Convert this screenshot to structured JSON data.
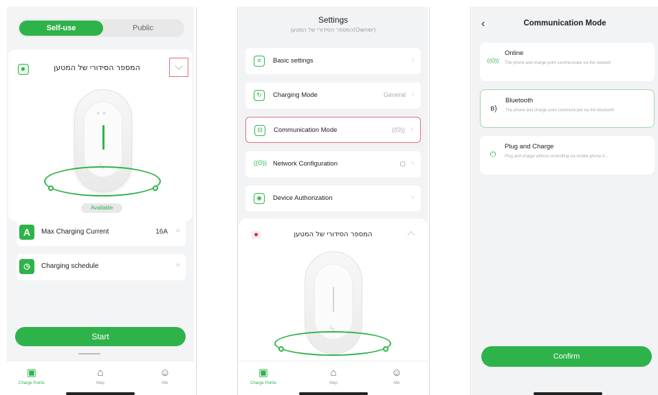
{
  "screen1": {
    "segment": {
      "active": "Self-use",
      "inactive": "Public"
    },
    "device_name": "המספר הסידורי של המטען",
    "status": "Available",
    "max_current": {
      "label": "Max Charging Current",
      "value": "16A"
    },
    "schedule": {
      "label": "Charging schedule"
    },
    "start_label": "Start",
    "tabs": [
      {
        "label": "Charge Points",
        "icon": "charger-icon"
      },
      {
        "label": "Map",
        "icon": "map-icon"
      },
      {
        "label": "Me",
        "icon": "user-icon"
      }
    ]
  },
  "screen2": {
    "title": "Settings",
    "subtitle": "המספר הסידורי של המטען(Owner)",
    "rows": [
      {
        "label": "Basic settings",
        "value": ""
      },
      {
        "label": "Charging Mode",
        "value": "General"
      },
      {
        "label": "Communication Mode",
        "value": "((ʘ))"
      },
      {
        "label": "Network Configuration",
        "value": ""
      },
      {
        "label": "Device Authorization",
        "value": ""
      }
    ],
    "device_name": "המספר הסידורי של המטען",
    "tabs": [
      {
        "label": "Charge Points"
      },
      {
        "label": "Map"
      },
      {
        "label": "Me"
      }
    ]
  },
  "screen3": {
    "title": "Communication Mode",
    "modes": [
      {
        "title": "Online",
        "desc": "The phone and charge point communicate via the network"
      },
      {
        "title": "Bluetooth",
        "desc": "The phone and charge point communicate via the bluetooth"
      },
      {
        "title": "Plug and Charge",
        "desc": "Plug and charge without controlling via mobile phone A..."
      }
    ],
    "confirm_label": "Confirm"
  },
  "colors": {
    "accent": "#2eb34a",
    "highlight": "#e0707a"
  }
}
